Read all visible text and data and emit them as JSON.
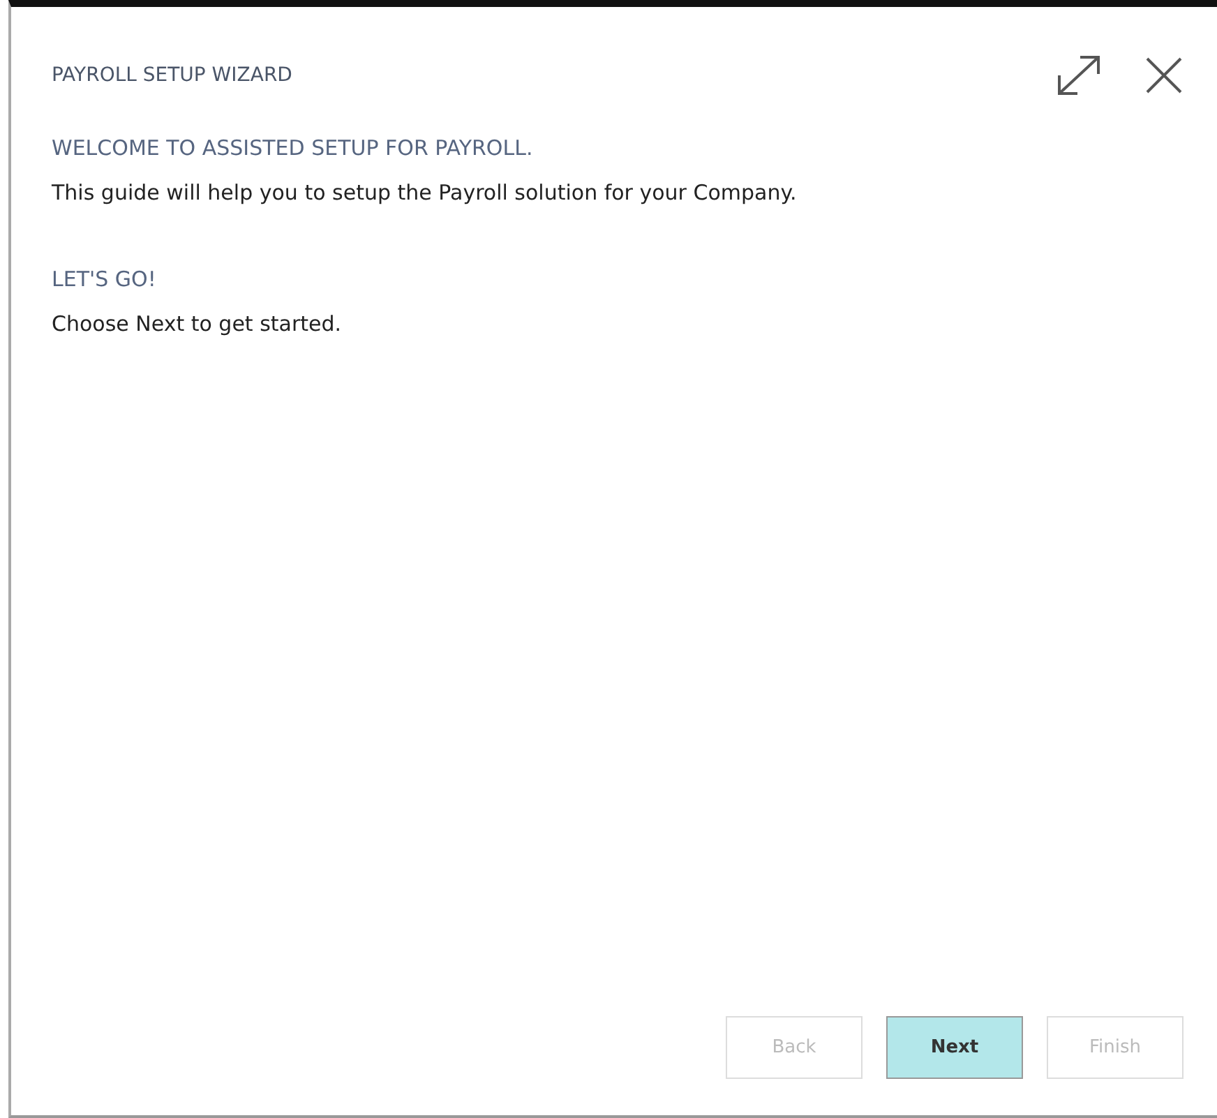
{
  "window": {
    "title": "PAYROLL SETUP WIZARD"
  },
  "sections": [
    {
      "heading": "WELCOME TO ASSISTED SETUP FOR PAYROLL.",
      "text": "This guide will help you to setup the Payroll solution for your Company."
    },
    {
      "heading": "LET'S GO!",
      "text": "Choose Next to get started."
    }
  ],
  "buttons": [
    {
      "label": "Back",
      "disabled": true,
      "kind": "default"
    },
    {
      "label": "Next",
      "disabled": false,
      "kind": "primary"
    },
    {
      "label": "Finish",
      "disabled": true,
      "kind": "default"
    }
  ]
}
